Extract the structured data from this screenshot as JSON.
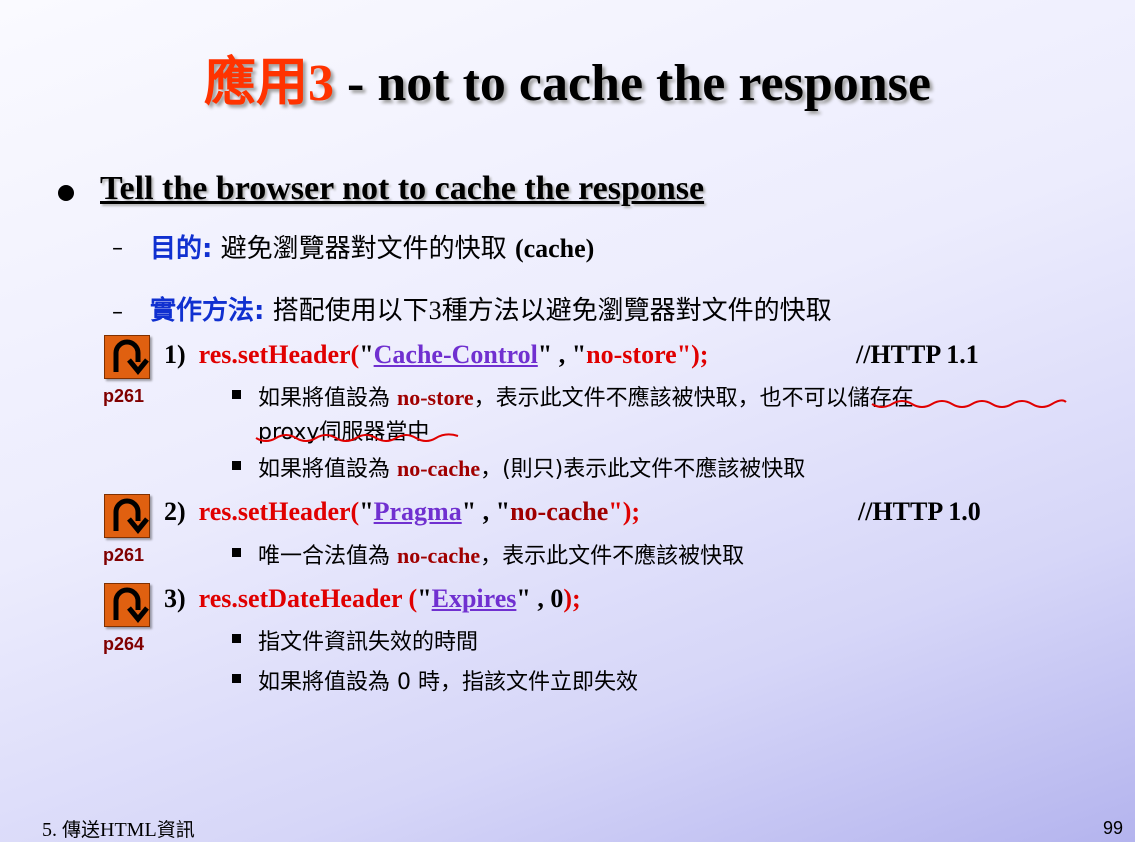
{
  "title": {
    "cjk": "應用",
    "num": "3",
    "rest": " - not to cache the response"
  },
  "heading": "Tell the browser not to cache the response",
  "purpose": {
    "dash": "–",
    "label": "目的:",
    "text": " 避免瀏覽器對文件的快取 ",
    "paren": "(cache)"
  },
  "impl": {
    "dash": "–",
    "label": "實作方法:",
    "text1": " 搭配使用以下",
    "num": "3",
    "text2": "種方法以避免瀏覽器對文件的快取"
  },
  "methods": [
    {
      "page_ref": "p261",
      "num": "1)",
      "call": "res.setHeader(",
      "q1": "\"",
      "arg1": "Cache-Control",
      "q1b": "\" , \"",
      "arg2": "no-store",
      "end": "\");",
      "comment": "//HTTP 1.1",
      "notes": [
        {
          "pre": "如果將值設為 ",
          "kw": "no-store",
          "post": "，表示此文件不應該被快取，",
          "post2": "也不可以儲存在",
          "line2": "proxy伺服器當中"
        },
        {
          "pre": "如果將值設為 ",
          "kw": "no-cache",
          "post": "，(則只)表示此文件不應該被快取"
        }
      ]
    },
    {
      "page_ref": "p261",
      "num": "2)",
      "call": "res.setHeader(",
      "q1": "\"",
      "arg1": "Pragma",
      "q1b": "\" , \"",
      "arg2": "no-cache",
      "end": "\");",
      "comment": "//HTTP 1.0",
      "notes": [
        {
          "pre": "唯一合法值為 ",
          "kw": "no-cache",
          "post": "，表示此文件不應該被快取"
        }
      ]
    },
    {
      "page_ref": "p264",
      "num": "3)",
      "call": "res.setDateHeader (",
      "q1": "\"",
      "arg1": "Expires",
      "q1b": "\" , ",
      "arg2": "0",
      "end": ");",
      "notes": [
        {
          "text": "指文件資訊失效的時間"
        },
        {
          "text": "如果將值設為 0 時，指該文件立即失效"
        }
      ]
    }
  ],
  "footer": {
    "chapter_num": "5. ",
    "chapter_cjk1": "傳送",
    "chapter_en": "HTML",
    "chapter_cjk2": "資訊",
    "page_num": "99"
  },
  "colors": {
    "title_accent": "#ff3300",
    "label_blue": "#1030d0",
    "code_red": "#e00000",
    "keyword_darkred": "#a00000",
    "arg_purple": "#7030d0",
    "icon_orange": "#e06010"
  },
  "icons": {
    "book_ref": "u-turn-arrow-icon",
    "bullet": "filled-circle-icon"
  }
}
